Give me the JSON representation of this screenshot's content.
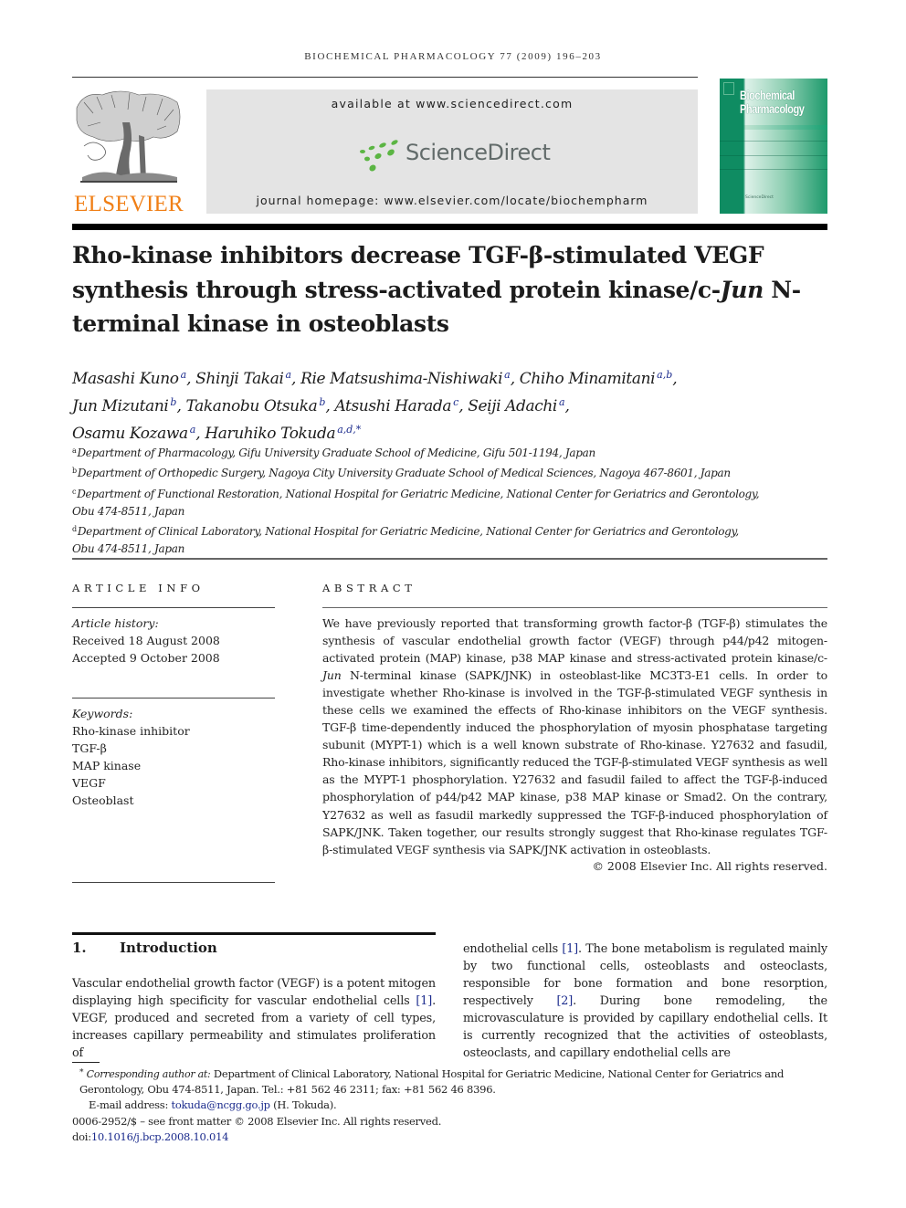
{
  "running_head": "BIOCHEMICAL PHARMACOLOGY 77 (2009) 196–203",
  "banner": {
    "publisher_logo": "ELSEVIER",
    "available_at": "available at www.sciencedirect.com",
    "sciencedirect_logo": "ScienceDirect",
    "journal_homepage": "journal homepage: www.elsevier.com/locate/biochempharm",
    "cover_title_line1": "Biochemical",
    "cover_title_line2": "Pharmacology",
    "cover_footer": "ScienceDirect",
    "colors": {
      "publisher_orange": "#f07f16",
      "sciencedirect_green": "#5bb543",
      "cover_green": "#0f8c62",
      "banner_gray": "#e4e4e4"
    }
  },
  "article": {
    "title_part1": "Rho-kinase inhibitors decrease TGF-β-stimulated VEGF synthesis through stress-activated protein kinase/c-",
    "title_italic": "Jun",
    "title_part2": " N-terminal kinase in osteoblasts",
    "authors": [
      {
        "name": "Masashi Kuno",
        "aff": "a"
      },
      {
        "name": "Shinji Takai",
        "aff": "a"
      },
      {
        "name": "Rie Matsushima-Nishiwaki",
        "aff": "a"
      },
      {
        "name": "Chiho Minamitani",
        "aff": "a,b"
      },
      {
        "name": "Jun Mizutani",
        "aff": "b"
      },
      {
        "name": "Takanobu Otsuka",
        "aff": "b"
      },
      {
        "name": "Atsushi Harada",
        "aff": "c"
      },
      {
        "name": "Seiji Adachi",
        "aff": "a"
      },
      {
        "name": "Osamu Kozawa",
        "aff": "a"
      },
      {
        "name": "Haruhiko Tokuda",
        "aff": "a,d,*"
      }
    ],
    "affiliations": [
      {
        "key": "a",
        "text": "Department of Pharmacology, Gifu University Graduate School of Medicine, Gifu 501-1194, Japan"
      },
      {
        "key": "b",
        "text": "Department of Orthopedic Surgery, Nagoya City University Graduate School of Medical Sciences, Nagoya 467-8601, Japan"
      },
      {
        "key": "c",
        "text": "Department of Functional Restoration, National Hospital for Geriatric Medicine, National Center for Geriatrics and Gerontology,",
        "cont": "Obu 474-8511, Japan"
      },
      {
        "key": "d",
        "text": "Department of Clinical Laboratory, National Hospital for Geriatric Medicine, National Center for Geriatrics and Gerontology,",
        "cont": "Obu 474-8511, Japan"
      }
    ]
  },
  "article_info": {
    "heading": "ARTICLE INFO",
    "history_label": "Article history:",
    "received": "Received 18 August 2008",
    "accepted": "Accepted 9 October 2008",
    "keywords_label": "Keywords:",
    "keywords": [
      "Rho-kinase inhibitor",
      "TGF-β",
      "MAP kinase",
      "VEGF",
      "Osteoblast"
    ]
  },
  "abstract": {
    "heading": "ABSTRACT",
    "text_a": "We have previously reported that transforming growth factor-β (TGF-β) stimulates the synthesis of vascular endothelial growth factor (VEGF) through p44/p42 mitogen-activated protein (MAP) kinase, p38 MAP kinase and stress-activated protein kinase/c-",
    "text_italic": "Jun",
    "text_b": " N-terminal kinase (SAPK/JNK) in osteoblast-like MC3T3-E1 cells. In order to investigate whether Rho-kinase is involved in the TGF-β-stimulated VEGF synthesis in these cells we examined the effects of Rho-kinase inhibitors on the VEGF synthesis. TGF-β time-dependently induced the phosphorylation of myosin phosphatase targeting subunit (MYPT-1) which is a well known substrate of Rho-kinase. Y27632 and fasudil, Rho-kinase inhibitors, significantly reduced the TGF-β-stimulated VEGF synthesis as well as the MYPT-1 phosphorylation. Y27632 and fasudil failed to affect the TGF-β-induced phosphorylation of p44/p42 MAP kinase, p38 MAP kinase or Smad2. On the contrary, Y27632 as well as fasudil markedly suppressed the TGF-β-induced phosphorylation of SAPK/JNK. Taken together, our results strongly suggest that Rho-kinase regulates TGF-β-stimulated VEGF synthesis via SAPK/JNK activation in osteoblasts.",
    "copyright": "© 2008 Elsevier Inc. All rights reserved."
  },
  "introduction": {
    "number": "1.",
    "heading": "Introduction",
    "col1_a": "Vascular endothelial growth factor (VEGF) is a potent mitogen displaying high specificity for vascular endothelial cells ",
    "col1_cite": "[1]",
    "col1_b": ". VEGF, produced and secreted from a variety of cell types, increases capillary permeability and stimulates proliferation of",
    "col2_a": "endothelial cells ",
    "col2_cite1": "[1]",
    "col2_b": ". The bone metabolism is regulated mainly by two functional cells, osteoblasts and osteoclasts, responsible for bone formation and bone resorption, respectively ",
    "col2_cite2": "[2]",
    "col2_c": ". During bone remodeling, the microvasculature is provided by capillary endothelial cells. It is currently recognized that the activities of osteoblasts, osteoclasts, and capillary endothelial cells are"
  },
  "footnotes": {
    "star": "*",
    "corresponding_label": "Corresponding author at:",
    "corresponding_text": " Department of Clinical Laboratory, National Hospital for Geriatric Medicine, National Center for Geriatrics and Gerontology, Obu 474-8511, Japan. Tel.: +81 562 46 2311; fax: +81 562 46 8396.",
    "email_label": "E-mail address: ",
    "email": "tokuda@ncgg.go.jp",
    "email_suffix": " (H. Tokuda).",
    "front_matter": "0006-2952/$ – see front matter © 2008 Elsevier Inc. All rights reserved.",
    "doi_label": "doi:",
    "doi": "10.1016/j.bcp.2008.10.014"
  }
}
